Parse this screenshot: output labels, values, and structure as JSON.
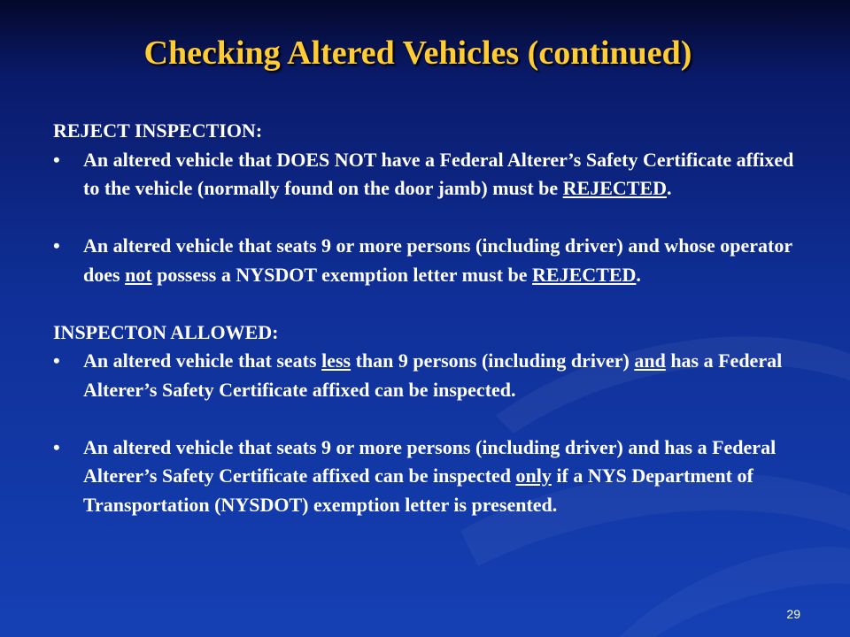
{
  "slide": {
    "title": "Checking Altered Vehicles (continued)",
    "page_number": "29"
  },
  "sections": [
    {
      "heading": "REJECT INSPECTION:",
      "items": [
        [
          {
            "text": "An altered vehicle that DOES NOT have a Federal Alterer’s Safety Certificate affixed to the vehicle (normally found on the door jamb) must be "
          },
          {
            "text": "REJECTED",
            "underline": true
          },
          {
            "text": "."
          }
        ],
        [
          {
            "text": "An altered vehicle that seats 9 or more persons (including driver) and whose operator does "
          },
          {
            "text": "not",
            "underline": true
          },
          {
            "text": " possess a NYSDOT exemption letter must be "
          },
          {
            "text": "REJECTED",
            "underline": true
          },
          {
            "text": "."
          }
        ]
      ]
    },
    {
      "heading": "INSPECTON ALLOWED:",
      "items": [
        [
          {
            "text": " An altered vehicle that seats "
          },
          {
            "text": "less",
            "underline": true
          },
          {
            "text": " than 9 persons (including driver) "
          },
          {
            "text": "and",
            "underline": true
          },
          {
            "text": " has a Federal Alterer’s Safety Certificate affixed can be inspected."
          }
        ],
        [
          {
            "text": "An altered vehicle that seats 9 or more persons (including driver) and has a Federal Alterer’s Safety Certificate affixed can be inspected "
          },
          {
            "text": "only",
            "underline": true
          },
          {
            "text": " if a NYS Department of Transportation (NYSDOT) exemption letter is presented."
          }
        ]
      ]
    }
  ],
  "bullet_glyph": "•",
  "colors": {
    "title": "#ffcc33",
    "text": "#ffffff",
    "background_top": "#04082a",
    "background_bottom": "#1540b4"
  }
}
